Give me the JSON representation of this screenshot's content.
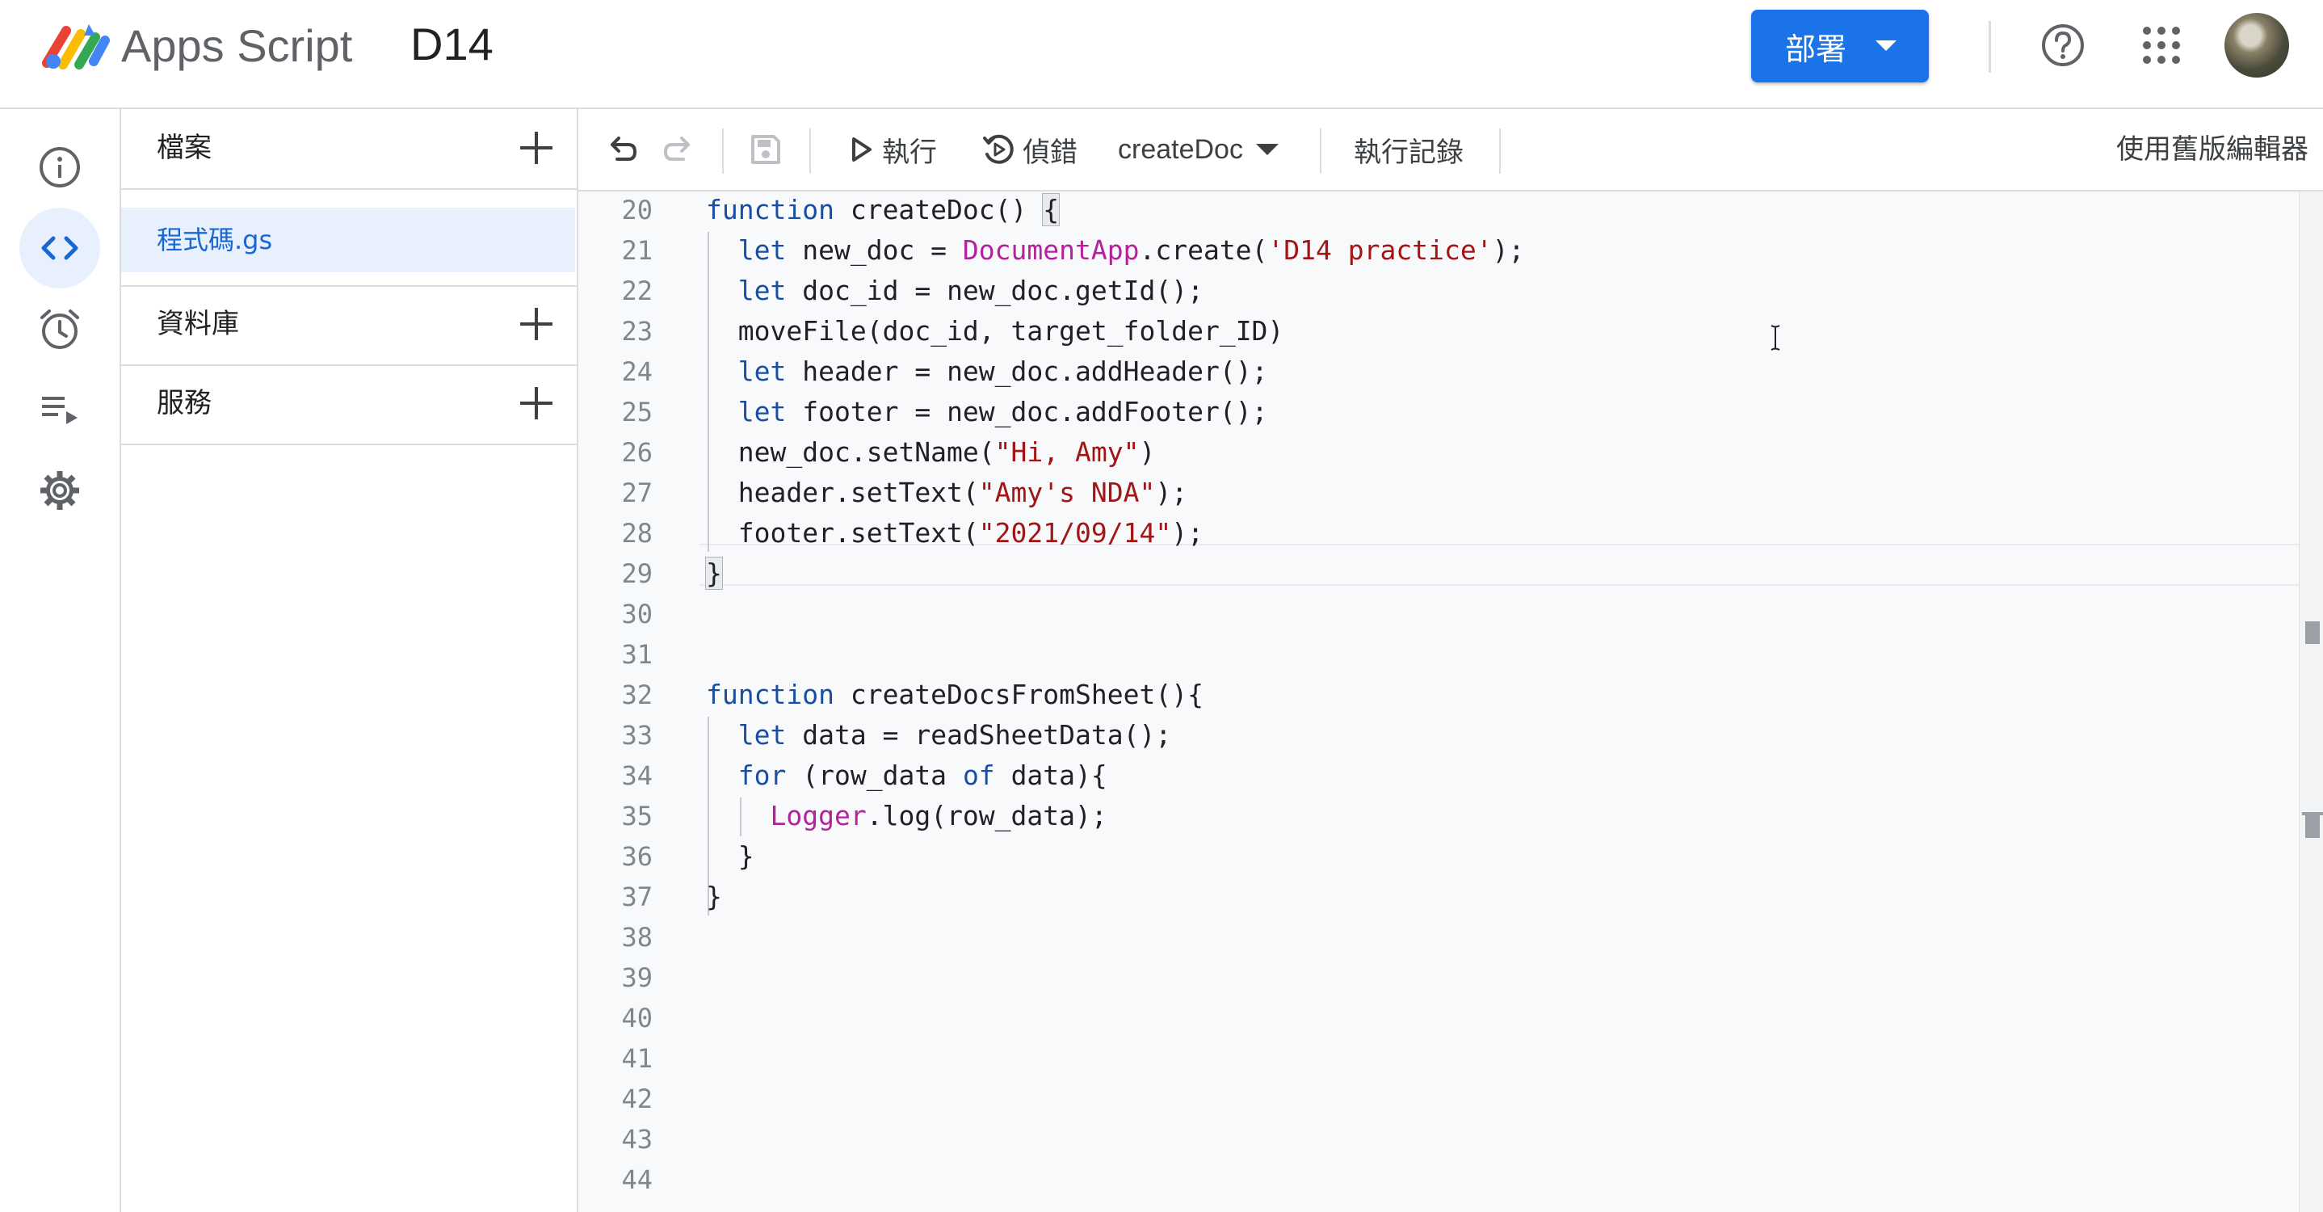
{
  "header": {
    "app_name": "Apps Script",
    "project_name": "D14",
    "deploy_label": "部署"
  },
  "rail": {
    "items": [
      {
        "icon": "info-icon",
        "active": false
      },
      {
        "icon": "code-icon",
        "active": true
      },
      {
        "icon": "alarm-clock-icon",
        "active": false
      },
      {
        "icon": "executions-list-icon",
        "active": false
      },
      {
        "icon": "gear-icon",
        "active": false
      }
    ]
  },
  "files_panel": {
    "files_label": "檔案",
    "files": [
      "程式碼.gs"
    ],
    "libraries_label": "資料庫",
    "services_label": "服務"
  },
  "toolbar": {
    "run_label": "執行",
    "debug_label": "偵錯",
    "function_name": "createDoc",
    "log_label": "執行記錄",
    "legacy_label": "使用舊版編輯器"
  },
  "editor": {
    "line_numbers": [
      "20",
      "21",
      "22",
      "23",
      "24",
      "25",
      "26",
      "27",
      "28",
      "29",
      "30",
      "31",
      "32",
      "33",
      "34",
      "35",
      "36",
      "37",
      "38",
      "39",
      "40",
      "41",
      "42",
      "43",
      "44"
    ],
    "lines": [
      "function createDoc() {",
      "  let new_doc = DocumentApp.create('D14 practice');",
      "  let doc_id = new_doc.getId();",
      "  moveFile(doc_id, target_folder_ID)",
      "  let header = new_doc.addHeader();",
      "  let footer = new_doc.addFooter();",
      "  new_doc.setName(\"Hi, Amy\")",
      "  header.setText(\"Amy's NDA\");",
      "  footer.setText(\"2021/09/14\");",
      "}",
      "",
      "",
      "function createDocsFromSheet(){",
      "  let data = readSheetData();",
      "  for (row_data of data){",
      "    Logger.log(row_data);",
      "  }",
      "}",
      "",
      "",
      "",
      "",
      "",
      "",
      ""
    ]
  },
  "colors": {
    "accent": "#1a73e8",
    "keyword": "#1a4fa0",
    "string": "#a31515",
    "class_name": "#b5219c"
  }
}
